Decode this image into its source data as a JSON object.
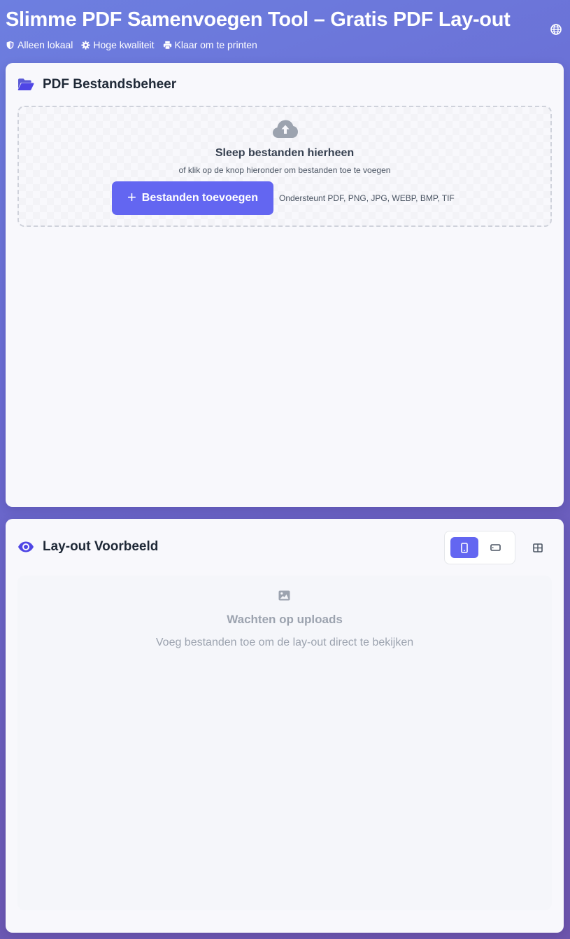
{
  "header": {
    "title": "Slimme PDF Samenvoegen Tool – Gratis PDF Lay-out",
    "badges": [
      {
        "icon": "shield-icon",
        "label": "Alleen lokaal"
      },
      {
        "icon": "gear-icon",
        "label": "Hoge kwaliteit"
      },
      {
        "icon": "printer-icon",
        "label": "Klaar om te printen"
      }
    ],
    "language_icon": "globe-icon"
  },
  "file_manager": {
    "icon": "folder-open-icon",
    "title": "PDF Bestandsbeheer",
    "dropzone": {
      "icon": "cloud-upload-icon",
      "title": "Sleep bestanden hierheen",
      "subtitle": "of klik op de knop hieronder om bestanden toe te voegen",
      "add_button_label": "Bestanden toevoegen",
      "supported_formats": "Ondersteunt PDF, PNG, JPG, WEBP, BMP, TIF"
    }
  },
  "layout_preview": {
    "icon": "eye-icon",
    "title": "Lay-out Voorbeeld",
    "orientation_options": [
      "portrait",
      "landscape"
    ],
    "selected_orientation": "portrait",
    "grid_icon": "grid-icon",
    "empty_state": {
      "icon": "image-icon",
      "title": "Wachten op uploads",
      "subtitle": "Voeg bestanden toe om de lay-out direct te bekijken"
    }
  },
  "colors": {
    "accent": "#6366f1",
    "background_start": "#6d7fe0",
    "background_end": "#6e55ad",
    "card": "#f8f8fc"
  }
}
